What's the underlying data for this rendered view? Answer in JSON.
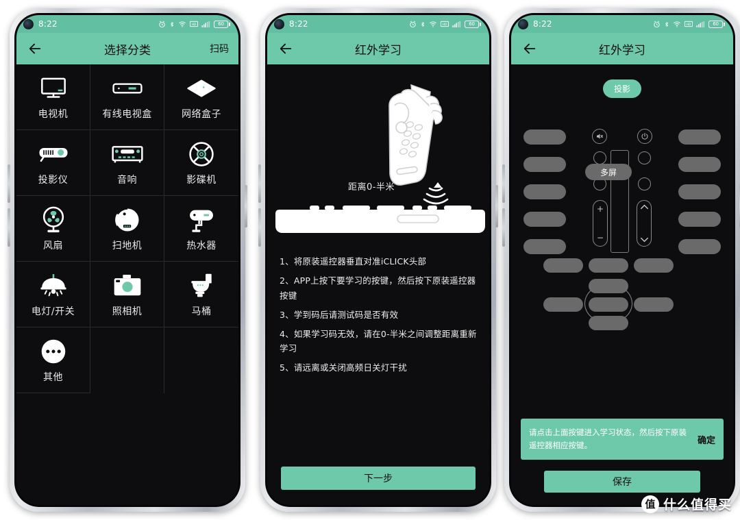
{
  "status_bar": {
    "time": "8:22",
    "battery_level": "60",
    "icons": [
      "alarm-icon",
      "bluetooth-icon",
      "wifi-icon",
      "hd-icon",
      "signal-icon",
      "battery-icon"
    ]
  },
  "phone1": {
    "appbar": {
      "back_icon": "back-arrow-icon",
      "title": "选择分类",
      "action_label": "扫码"
    },
    "categories": [
      {
        "label": "电视机",
        "icon": "television-icon"
      },
      {
        "label": "有线电视盒",
        "icon": "cable-box-icon"
      },
      {
        "label": "网络盒子",
        "icon": "network-box-icon"
      },
      {
        "label": "投影仪",
        "icon": "projector-icon"
      },
      {
        "label": "音响",
        "icon": "audio-receiver-icon"
      },
      {
        "label": "影碟机",
        "icon": "dvd-player-icon"
      },
      {
        "label": "风扇",
        "icon": "fan-icon"
      },
      {
        "label": "扫地机",
        "icon": "robot-vacuum-icon"
      },
      {
        "label": "热水器",
        "icon": "water-heater-icon"
      },
      {
        "label": "电灯/开关",
        "icon": "lamp-switch-icon"
      },
      {
        "label": "照相机",
        "icon": "camera-icon"
      },
      {
        "label": "马桶",
        "icon": "toilet-icon"
      },
      {
        "label": "其他",
        "icon": "more-dots-icon"
      }
    ]
  },
  "phone2": {
    "appbar": {
      "back_icon": "back-arrow-icon",
      "title": "红外学习"
    },
    "illustration": {
      "distance_label": "距离0-半米",
      "hand_remote_icon": "hand-holding-remote-icon",
      "signal_icon": "ir-signal-icon",
      "device_icon": "iclick-device-icon"
    },
    "steps": [
      "1、将原装遥控器垂直对准iCLICK头部",
      "2、APP上按下要学习的按键，然后按下原装遥控器按键",
      "3、学到码后请测试码是否有效",
      "4、如果学习码无效，请在0-半米之间调整距离重新学习",
      "5、请远离或关闭高频日关灯干扰"
    ],
    "next_button": "下一步"
  },
  "phone3": {
    "appbar": {
      "back_icon": "back-arrow-icon",
      "title": "红外学习"
    },
    "device_chip": "投影",
    "center_button": "多屏",
    "keys": {
      "mute_icon": "mute-icon",
      "power_icon": "power-icon",
      "volume_up": "+",
      "volume_down": "−",
      "channel_up_icon": "chevron-up-icon",
      "channel_down_icon": "chevron-down-icon"
    },
    "toast": {
      "message": "请点击上面按键进入学习状态，然后按下原装遥控器相应按键。",
      "confirm_label": "确定"
    },
    "save_button": "保存"
  },
  "watermark": {
    "badge": "值",
    "text": "什么值得买"
  },
  "colors": {
    "accent": "#6ec9ab",
    "statusbar": "#63bfa2",
    "screen_bg": "#0d0d0f",
    "key_gray": "#6a6a6a"
  }
}
